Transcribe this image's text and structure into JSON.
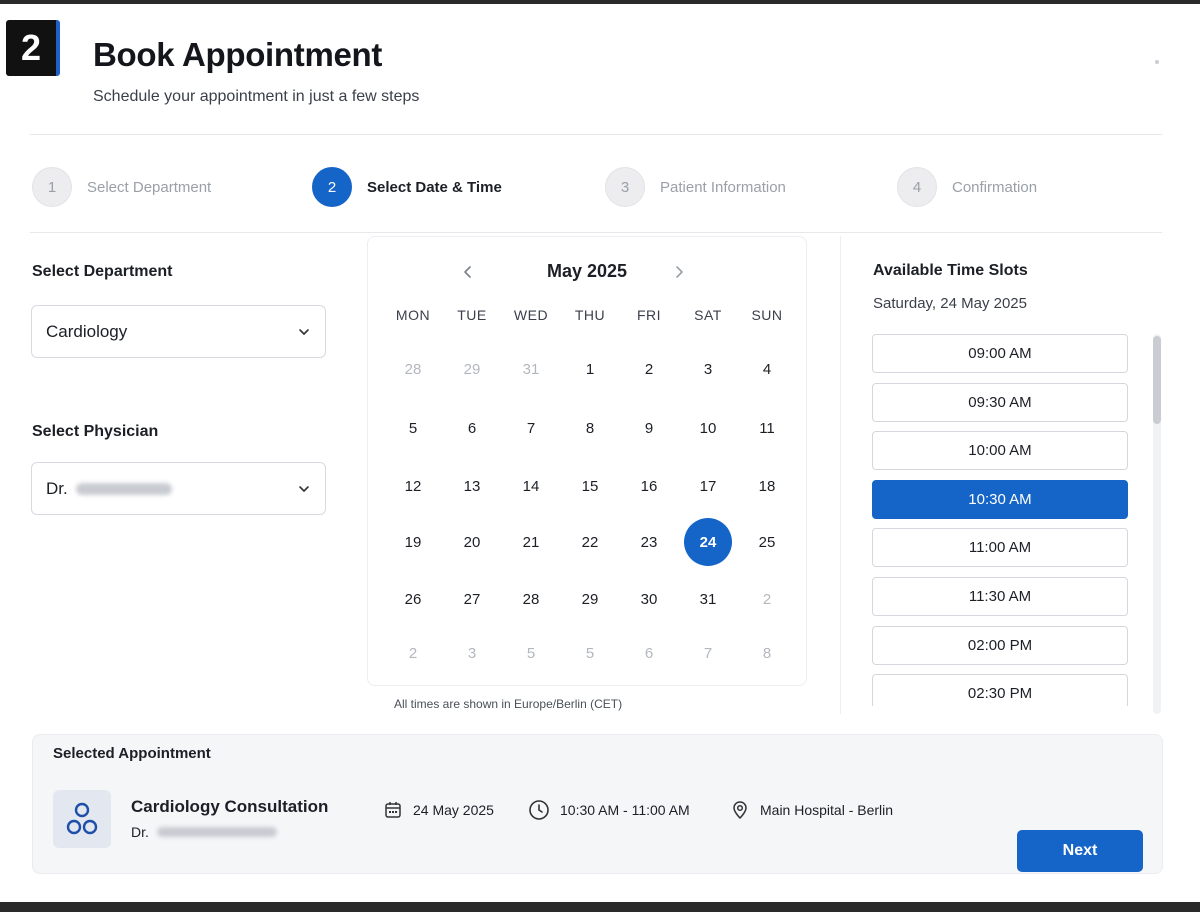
{
  "header": {
    "step_badge": "2",
    "title": "Book Appointment",
    "subtitle": "Schedule your appointment in just a few steps"
  },
  "stepper": [
    {
      "number": "1",
      "label": "Select Department",
      "state": "done"
    },
    {
      "number": "2",
      "label": "Select Date & Time",
      "state": "active"
    },
    {
      "number": "3",
      "label": "Patient Information",
      "state": "pending"
    },
    {
      "number": "4",
      "label": "Confirmation",
      "state": "pending"
    }
  ],
  "form": {
    "department_label": "Select Department",
    "department_value": "Cardiology",
    "physician_label": "Select Physician",
    "physician_value": "Dr."
  },
  "calendar": {
    "month": "May 2025",
    "weekdays": [
      "MON",
      "TUE",
      "WED",
      "THU",
      "FRI",
      "SAT",
      "SUN"
    ],
    "weeks": [
      [
        {
          "d": "28",
          "m": true
        },
        {
          "d": "29",
          "m": true
        },
        {
          "d": "31",
          "m": true
        },
        {
          "d": "1"
        },
        {
          "d": "2"
        },
        {
          "d": "3"
        },
        {
          "d": "4"
        }
      ],
      [
        {
          "d": "5"
        },
        {
          "d": "6"
        },
        {
          "d": "7"
        },
        {
          "d": "8"
        },
        {
          "d": "9"
        },
        {
          "d": "10"
        },
        {
          "d": "11"
        }
      ],
      [
        {
          "d": "12"
        },
        {
          "d": "13"
        },
        {
          "d": "14"
        },
        {
          "d": "15"
        },
        {
          "d": "16"
        },
        {
          "d": "17"
        },
        {
          "d": "18"
        }
      ],
      [
        {
          "d": "19"
        },
        {
          "d": "20"
        },
        {
          "d": "21"
        },
        {
          "d": "22"
        },
        {
          "d": "23"
        },
        {
          "d": "24",
          "s": true
        },
        {
          "d": "25"
        }
      ],
      [
        {
          "d": "26"
        },
        {
          "d": "27"
        },
        {
          "d": "28"
        },
        {
          "d": "29"
        },
        {
          "d": "30"
        },
        {
          "d": "31"
        },
        {
          "d": "2",
          "m": true
        }
      ],
      [
        {
          "d": "2",
          "m": true
        },
        {
          "d": "3",
          "m": true
        },
        {
          "d": "5",
          "m": true
        },
        {
          "d": "5",
          "m": true
        },
        {
          "d": "6",
          "m": true
        },
        {
          "d": "7",
          "m": true
        },
        {
          "d": "8",
          "m": true
        }
      ]
    ],
    "timezone_note": "All times are shown in Europe/Berlin (CET)"
  },
  "slots": {
    "title": "Available Time Slots",
    "date": "Saturday, 24 May 2025",
    "items": [
      {
        "time": "09:00 AM"
      },
      {
        "time": "09:30 AM"
      },
      {
        "time": "10:00 AM"
      },
      {
        "time": "10:30 AM",
        "selected": true
      },
      {
        "time": "11:00 AM"
      },
      {
        "time": "11:30 AM"
      },
      {
        "time": "02:00 PM"
      },
      {
        "time": "02:30 PM"
      }
    ]
  },
  "summary": {
    "title": "Selected Appointment",
    "name": "Cardiology Consultation",
    "doctor": "Dr.",
    "date": "24 May 2025",
    "time": "10:30 AM - 11:00 AM",
    "location": "Main Hospital - Berlin",
    "next_label": "Next"
  },
  "colors": {
    "accent": "#1565c8"
  }
}
